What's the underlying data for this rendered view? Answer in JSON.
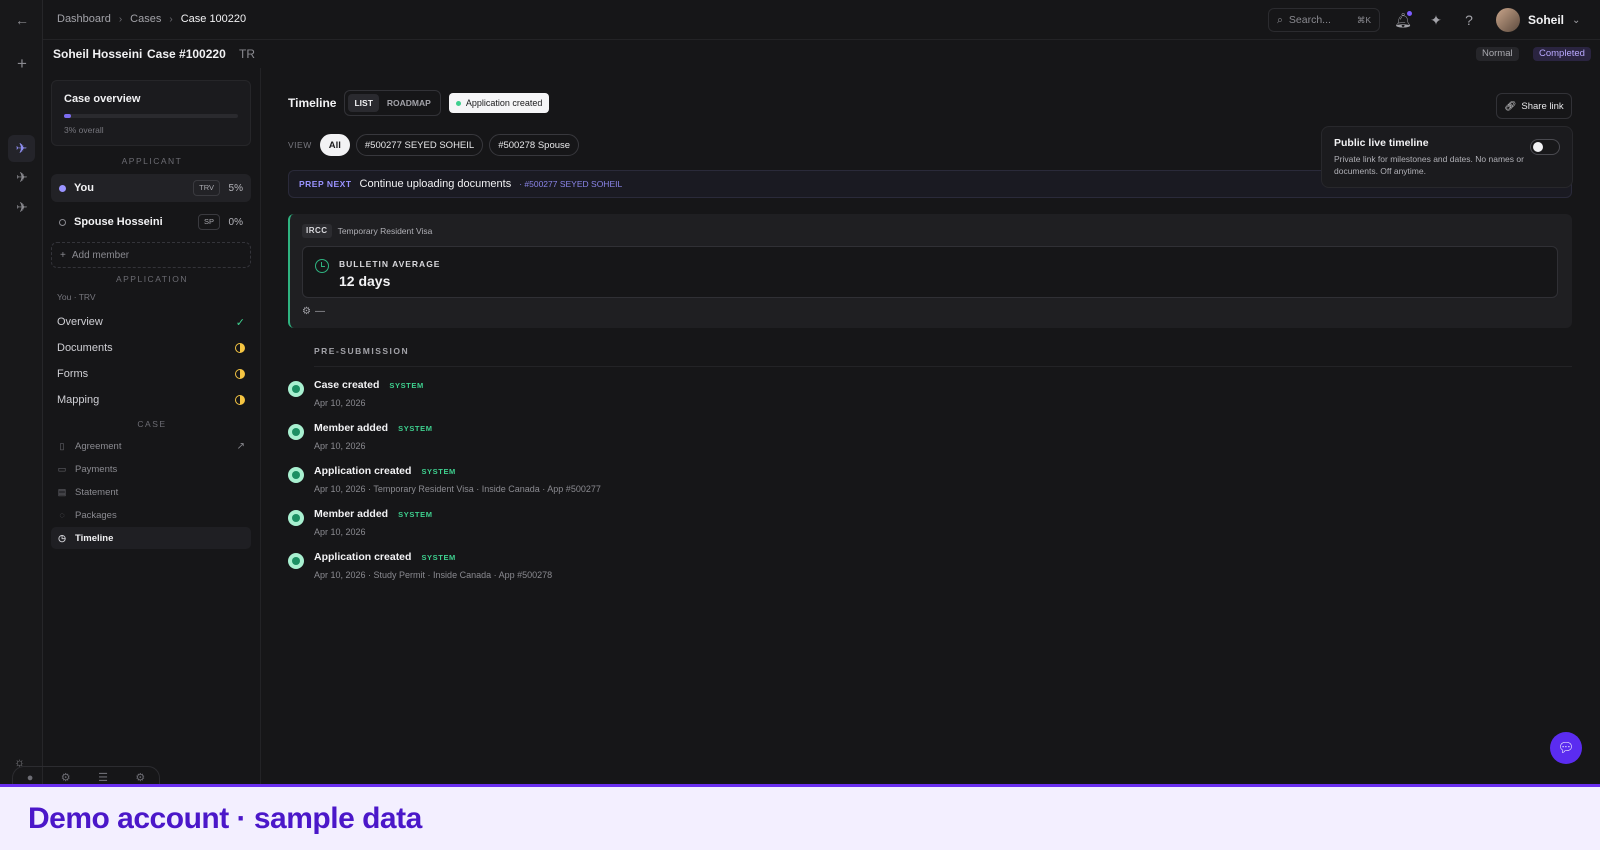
{
  "breadcrumbs": [
    "Dashboard",
    "Cases",
    "Case 100220"
  ],
  "search": {
    "placeholder": "Search...",
    "shortcut": "⌘K"
  },
  "user": {
    "name": "Soheil"
  },
  "header": {
    "client_name": "Soheil Hosseini",
    "case_id": "Case #100220",
    "case_code": "TR",
    "priority": "Normal",
    "status": "Completed"
  },
  "overview": {
    "title": "Case overview",
    "progress_fraction": 0.03,
    "progress_text": "3% overall"
  },
  "sections": {
    "applicant": "APPLICANT",
    "application": "APPLICATION",
    "case": "CASE"
  },
  "members": [
    {
      "name": "You",
      "tag": "TRV",
      "pct": "5%"
    },
    {
      "name": "Spouse Hosseini",
      "tag": "SP",
      "pct": "0%"
    }
  ],
  "add_member": "Add member",
  "application_sub": "You · TRV",
  "application_items": [
    {
      "label": "Overview",
      "status": "check"
    },
    {
      "label": "Documents",
      "status": "half"
    },
    {
      "label": "Forms",
      "status": "half"
    },
    {
      "label": "Mapping",
      "status": "half"
    }
  ],
  "case_items": [
    {
      "label": "Agreement",
      "icon": "document-icon"
    },
    {
      "label": "Payments",
      "icon": "card-icon"
    },
    {
      "label": "Statement",
      "icon": "statement-icon"
    },
    {
      "label": "Packages",
      "icon": "package-icon"
    },
    {
      "label": "Timeline",
      "icon": "clock-icon"
    }
  ],
  "timeline": {
    "title": "Timeline",
    "view_modes": [
      "LIST",
      "ROADMAP"
    ],
    "status_pill": "Application created",
    "share_label": "Share link",
    "view_label": "VIEW",
    "filters": [
      "All",
      "#500277 SEYED SOHEIL",
      "#500278 Spouse"
    ]
  },
  "live_timeline": {
    "title": "Public live timeline",
    "desc": "Private link for milestones and dates. No names or documents. Off anytime.",
    "enabled": false
  },
  "prep_next": {
    "label": "PREP NEXT",
    "text": "Continue uploading documents",
    "ref": "· #500277 SEYED SOHEIL"
  },
  "ircc": {
    "code": "IRCC",
    "visa": "Temporary Resident Visa",
    "bulletin_label": "BULLETIN AVERAGE",
    "bulletin_value": "12 days",
    "extra": "—"
  },
  "phase": "PRE-SUBMISSION",
  "events": [
    {
      "title": "Case created",
      "tag": "SYSTEM",
      "detail": "Apr 10, 2026"
    },
    {
      "title": "Member added",
      "tag": "SYSTEM",
      "detail": "Apr 10, 2026"
    },
    {
      "title": "Application created",
      "tag": "SYSTEM",
      "detail": "Apr 10, 2026 · Temporary Resident Visa · Inside Canada · App #500277"
    },
    {
      "title": "Member added",
      "tag": "SYSTEM",
      "detail": "Apr 10, 2026"
    },
    {
      "title": "Application created",
      "tag": "SYSTEM",
      "detail": "Apr 10, 2026 · Study Permit · Inside Canada · App #500278"
    }
  ],
  "banner": "Demo account · sample data",
  "colors": {
    "accent": "#7c6cf0",
    "success": "#3ecf8e",
    "warning": "#f5c542",
    "banner_text": "#4b17c9"
  }
}
